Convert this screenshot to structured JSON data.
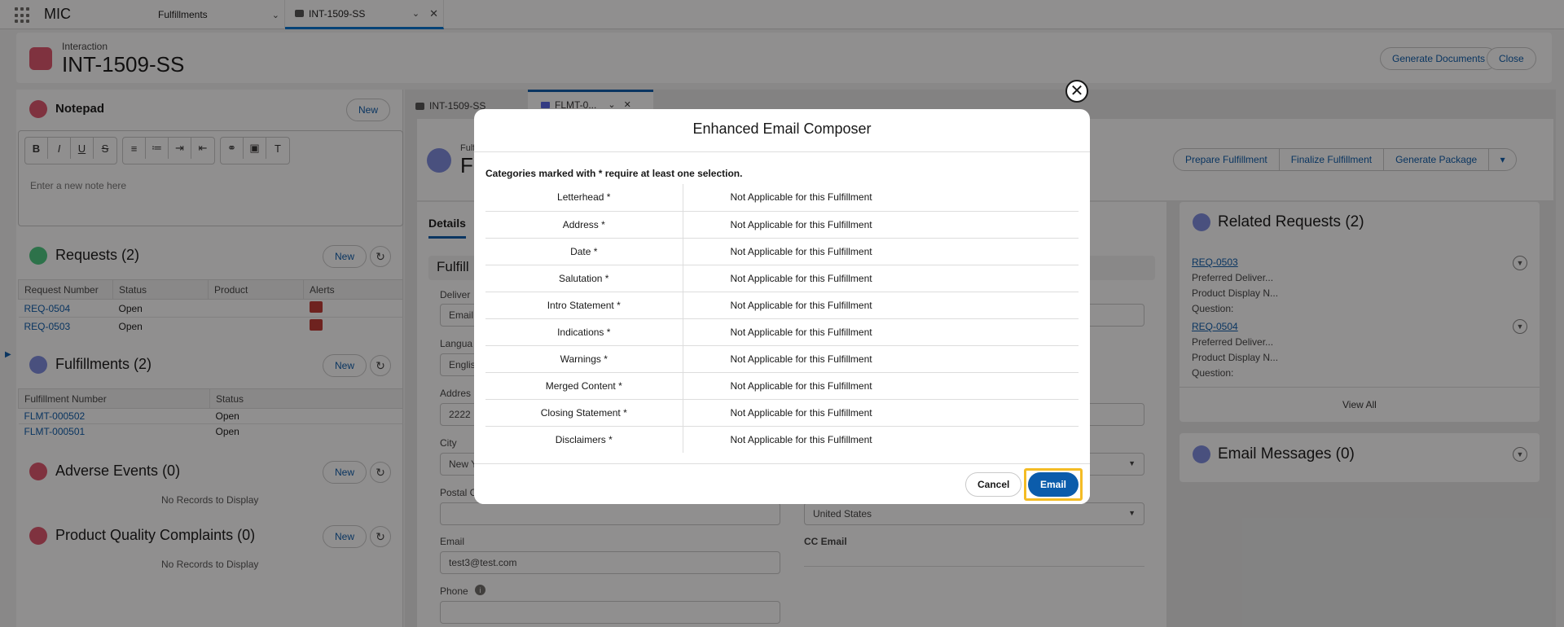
{
  "app": {
    "name": "MIC"
  },
  "nav_tabs": [
    {
      "label": "Fulfillments"
    },
    {
      "label": "INT-1509-SS"
    }
  ],
  "header": {
    "subtitle": "Interaction",
    "title": "INT-1509-SS",
    "generate_documents": "Generate Documents",
    "close": "Close"
  },
  "notepad": {
    "title": "Notepad",
    "new_label": "New",
    "placeholder": "Enter a new note here"
  },
  "requests": {
    "title": "Requests (2)",
    "new_label": "New",
    "columns": [
      "Request Number",
      "Status",
      "Product",
      "Alerts"
    ],
    "rows": [
      {
        "number": "REQ-0504",
        "status": "Open"
      },
      {
        "number": "REQ-0503",
        "status": "Open"
      }
    ]
  },
  "fulfillments": {
    "title": "Fulfillments (2)",
    "new_label": "New",
    "columns": [
      "Fulfillment Number",
      "Status"
    ],
    "rows": [
      {
        "number": "FLMT-000502",
        "status": "Open"
      },
      {
        "number": "FLMT-000501",
        "status": "Open"
      }
    ]
  },
  "adverse_events": {
    "title": "Adverse Events (0)",
    "new_label": "New",
    "empty": "No Records to Display"
  },
  "pqc": {
    "title": "Product Quality Complaints (0)",
    "new_label": "New",
    "empty": "No Records to Display"
  },
  "subtabs": [
    {
      "label": "INT-1509-SS"
    },
    {
      "label": "FLMT-0..."
    }
  ],
  "record": {
    "title_fragment_small": "Fulfi",
    "title_fragment": "F",
    "actions": [
      "Prepare Fulfillment",
      "Finalize Fulfillment",
      "Generate Package"
    ],
    "details_tab": "Details",
    "section_fragment": "Fulfill",
    "fields": {
      "delivery_label": "Deliver",
      "delivery_value": "Email",
      "language_label": "Langua",
      "language_value": "Englis",
      "address_label": "Addres",
      "address_value": "2222",
      "city_label": "City",
      "city_value": "New Y",
      "postal_label": "Postal C",
      "country_value": "United States",
      "email_label": "Email",
      "email_value": "test3@test.com",
      "cc_email_label": "CC Email",
      "phone_label": "Phone"
    }
  },
  "related_requests": {
    "title": "Related Requests (2)",
    "items": [
      {
        "number": "REQ-0503",
        "line1": "Preferred Deliver...",
        "line2": "Product Display N...",
        "line3": "Question:"
      },
      {
        "number": "REQ-0504",
        "line1": "Preferred Deliver...",
        "line2": "Product Display N...",
        "line3": "Question:"
      }
    ],
    "view_all": "View All"
  },
  "email_messages": {
    "title": "Email Messages (0)"
  },
  "modal": {
    "title": "Enhanced Email Composer",
    "note": "Categories marked with * require at least one selection.",
    "categories": [
      {
        "name": "Letterhead *",
        "value": "Not Applicable for this Fulfillment"
      },
      {
        "name": "Address *",
        "value": "Not Applicable for this Fulfillment"
      },
      {
        "name": "Date *",
        "value": "Not Applicable for this Fulfillment"
      },
      {
        "name": "Salutation *",
        "value": "Not Applicable for this Fulfillment"
      },
      {
        "name": "Intro Statement *",
        "value": "Not Applicable for this Fulfillment"
      },
      {
        "name": "Indications *",
        "value": "Not Applicable for this Fulfillment"
      },
      {
        "name": "Warnings *",
        "value": "Not Applicable for this Fulfillment"
      },
      {
        "name": "Merged Content *",
        "value": "Not Applicable for this Fulfillment"
      },
      {
        "name": "Closing Statement *",
        "value": "Not Applicable for this Fulfillment"
      },
      {
        "name": "Disclaimers *",
        "value": "Not Applicable for this Fulfillment"
      }
    ],
    "cancel": "Cancel",
    "email": "Email"
  },
  "colors": {
    "brand": "#0b5cab",
    "highlight": "#f4bc25",
    "interaction_icon": "#e0566d"
  }
}
